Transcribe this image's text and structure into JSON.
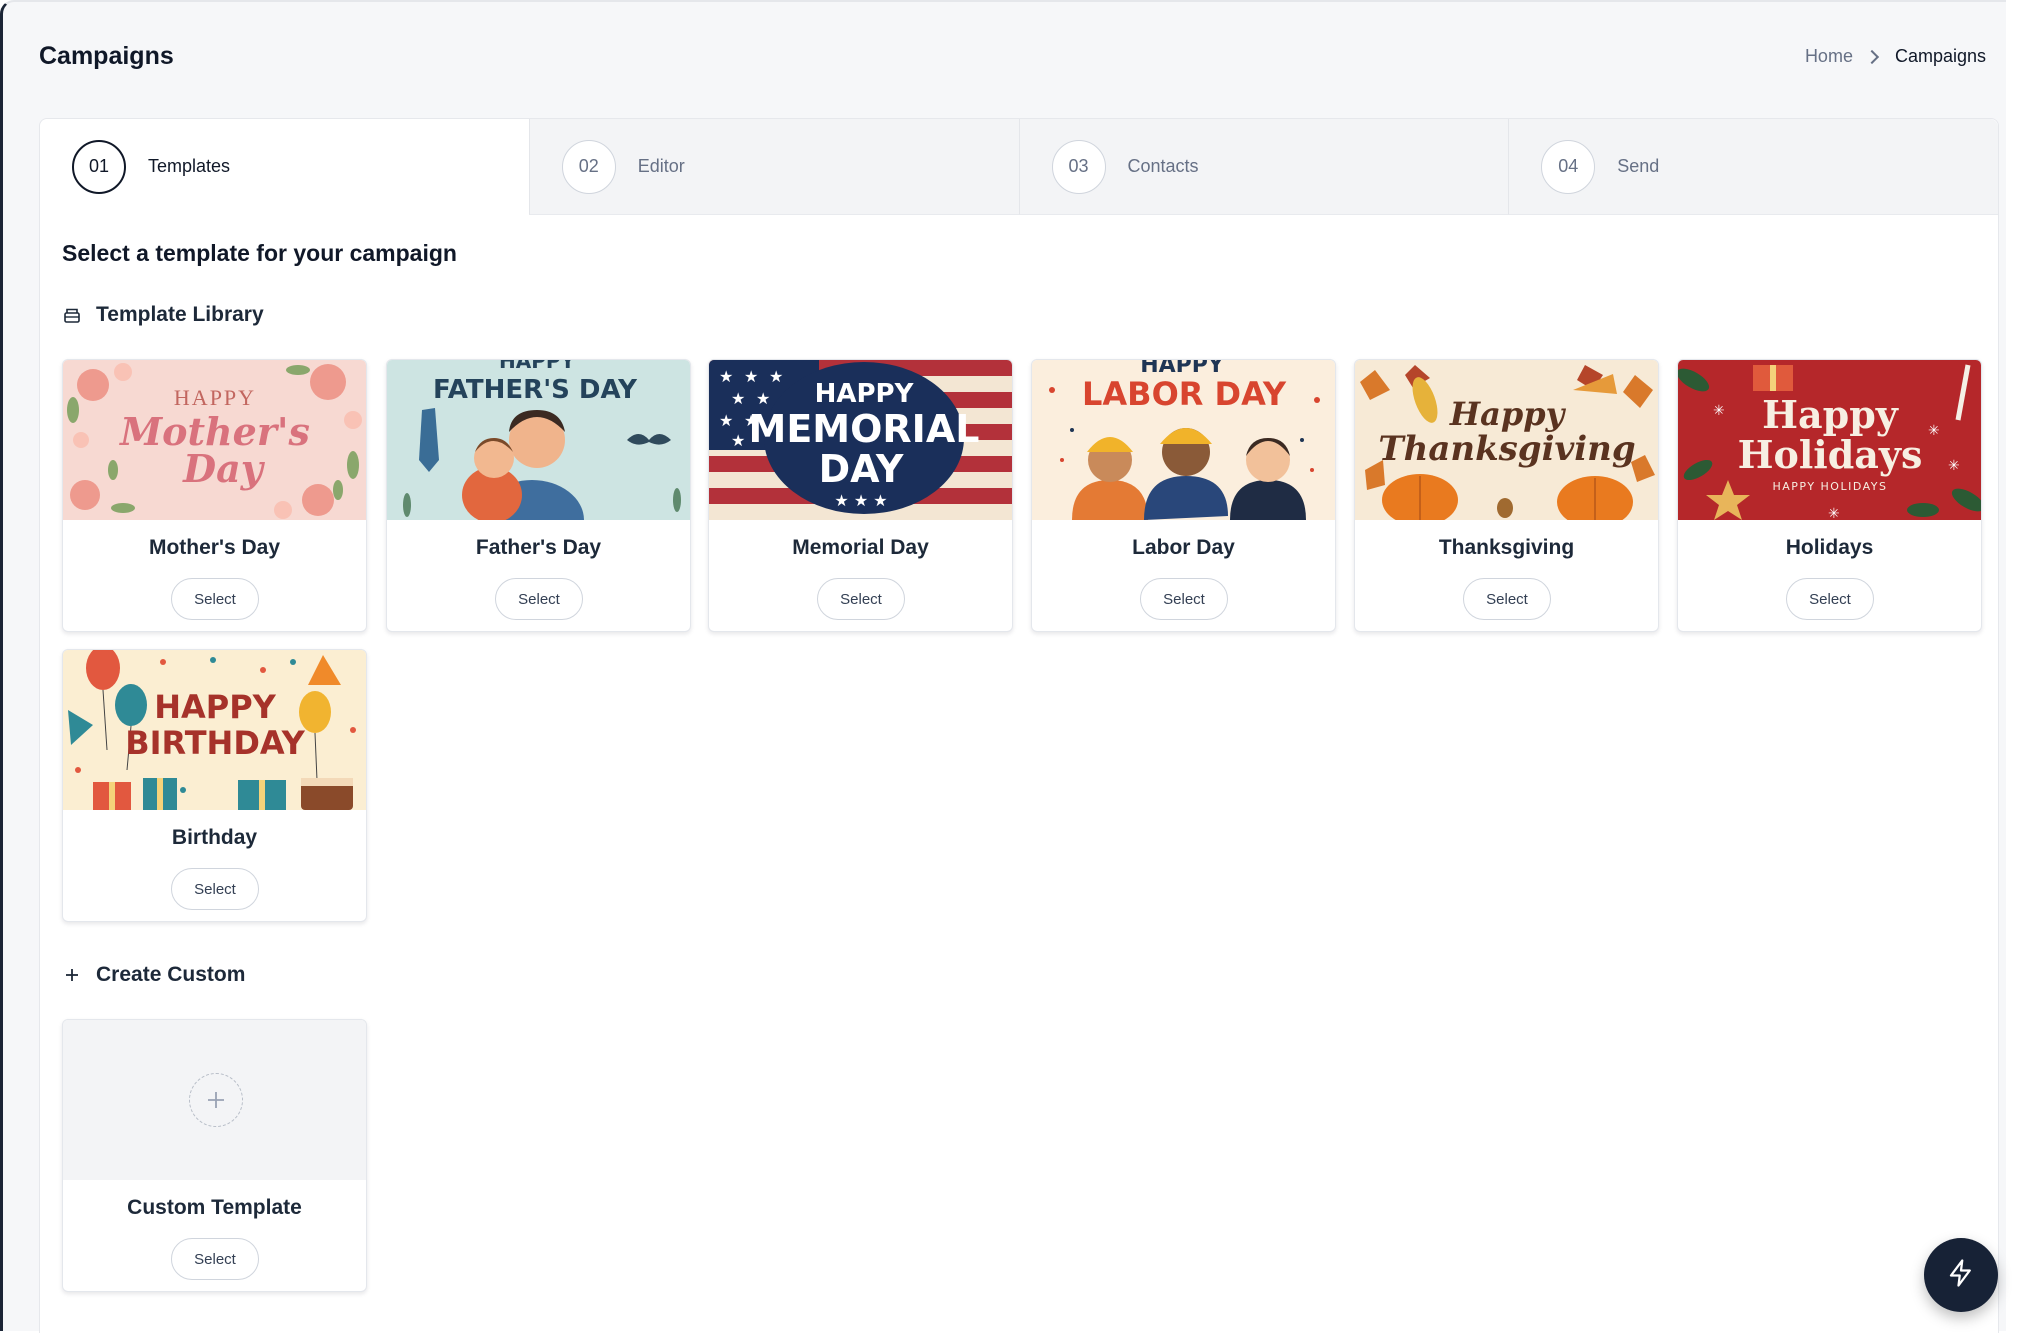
{
  "header": {
    "title": "Campaigns",
    "breadcrumb": [
      "Home",
      "Campaigns"
    ]
  },
  "steps": [
    {
      "num": "01",
      "label": "Templates",
      "active": true
    },
    {
      "num": "02",
      "label": "Editor",
      "active": false
    },
    {
      "num": "03",
      "label": "Contacts",
      "active": false
    },
    {
      "num": "04",
      "label": "Send",
      "active": false
    }
  ],
  "content": {
    "subtitle": "Select a template for your campaign",
    "library_heading": "Template Library",
    "custom_heading": "Create Custom",
    "select_label": "Select"
  },
  "templates": [
    {
      "name": "Mother's Day",
      "art": {
        "line1": "HAPPY",
        "line2": "Mother's",
        "line3": "Day"
      }
    },
    {
      "name": "Father's Day",
      "art": {
        "line1": "HAPPY",
        "line2": "FATHER'S DAY"
      }
    },
    {
      "name": "Memorial Day",
      "art": {
        "line1": "HAPPY",
        "line2": "MEMORIAL",
        "line3": "DAY"
      }
    },
    {
      "name": "Labor Day",
      "art": {
        "line1": "HAPPY",
        "line2": "LABOR DAY"
      }
    },
    {
      "name": "Thanksgiving",
      "art": {
        "line1": "Happy",
        "line2": "Thanksgiving"
      }
    },
    {
      "name": "Holidays",
      "art": {
        "line1": "Happy",
        "line2": "Holidays",
        "line3": "HAPPY HOLIDAYS"
      }
    },
    {
      "name": "Birthday",
      "art": {
        "line1": "HAPPY",
        "line2": "BIRTHDAY"
      }
    }
  ],
  "custom": {
    "name": "Custom Template"
  },
  "colors": {
    "accent_dark": "#172236",
    "border": "#e4e7ec",
    "muted_text": "#667085"
  },
  "icons": {
    "library": "archive-box-icon",
    "custom": "plus-icon",
    "fab": "lightning-bolt-icon"
  }
}
